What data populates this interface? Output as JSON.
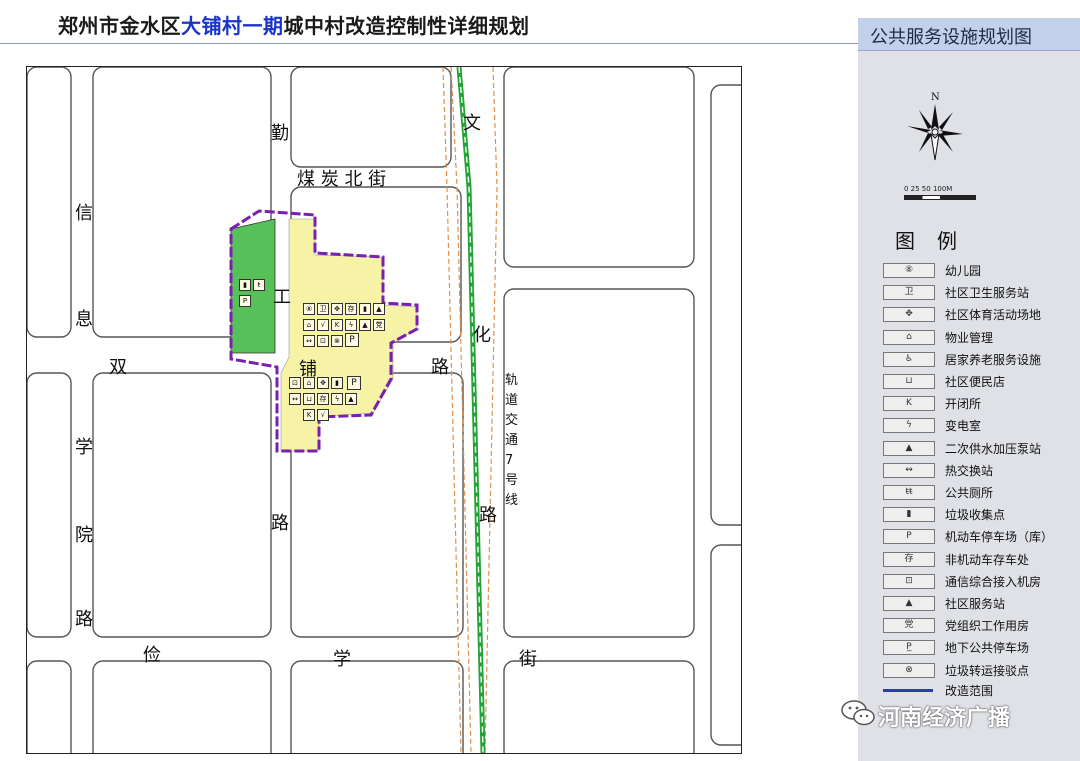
{
  "header": {
    "title_part1": "郑州市金水区",
    "title_highlight": "大铺村一期",
    "title_part2": "城中村改造控制性详细规划"
  },
  "panel": {
    "title": "公共服务设施规划图"
  },
  "compass": {
    "north_label": "N"
  },
  "scale": {
    "ticks": "0  25  50      100M"
  },
  "legend": {
    "title": "图例",
    "items": [
      {
        "label": "幼儿园",
        "icon": "kindergarten-icon",
        "glyph": "⑧"
      },
      {
        "label": "社区卫生服务站",
        "icon": "health-station-icon",
        "glyph": "卫"
      },
      {
        "label": "社区体育活动场地",
        "icon": "sports-field-icon",
        "glyph": "✥"
      },
      {
        "label": "物业管理",
        "icon": "property-management-icon",
        "glyph": "⌂"
      },
      {
        "label": "居家养老服务设施",
        "icon": "elderly-care-icon",
        "glyph": "♿"
      },
      {
        "label": "社区便民店",
        "icon": "convenience-store-icon",
        "glyph": "⊔"
      },
      {
        "label": "开闭所",
        "icon": "switching-station-icon",
        "glyph": "K"
      },
      {
        "label": "变电室",
        "icon": "substation-icon",
        "glyph": "ϟ"
      },
      {
        "label": "二次供水加压泵站",
        "icon": "water-pump-icon",
        "glyph": "▲"
      },
      {
        "label": "热交换站",
        "icon": "heat-exchange-icon",
        "glyph": "↭"
      },
      {
        "label": "公共厕所",
        "icon": "public-toilet-icon",
        "glyph": "ŧŧ"
      },
      {
        "label": "垃圾收集点",
        "icon": "garbage-point-icon",
        "glyph": "▮"
      },
      {
        "label": "机动车停车场（库）",
        "icon": "parking-icon",
        "glyph": "P"
      },
      {
        "label": "非机动车存车处",
        "icon": "bike-parking-icon",
        "glyph": "存"
      },
      {
        "label": "通信综合接入机房",
        "icon": "telecom-room-icon",
        "glyph": "⊡"
      },
      {
        "label": "社区服务站",
        "icon": "community-service-icon",
        "glyph": "▲"
      },
      {
        "label": "党组织工作用房",
        "icon": "party-office-icon",
        "glyph": "党"
      },
      {
        "label": "地下公共停车场",
        "icon": "underground-parking-icon",
        "glyph": "P̲"
      },
      {
        "label": "垃圾转运接驳点",
        "icon": "garbage-transfer-icon",
        "glyph": "⊗"
      }
    ],
    "boundary_label": "改造范围",
    "boundary_color": "#2b3fa8"
  },
  "map": {
    "roads": {
      "qingong": "勤",
      "gong": "工",
      "lu_left": "路",
      "meitan": "煤  炭  北  街",
      "xinxi_1": "信",
      "xinxi_2": "息",
      "xinxi_3": "学",
      "xinxi_4": "院",
      "xinxi_5": "路",
      "shuangpu_1": "双",
      "shuangpu_2": "铺",
      "shuangpu_3": "路",
      "wen": "文",
      "hua": "化",
      "lu_right": "路",
      "rail": "轨道交通7号线",
      "jianxue_1": "俭",
      "jianxue_2": "学",
      "jianxue_3": "街"
    },
    "colors": {
      "green_area": "#58c058",
      "yellow_area": "#f6f3a6",
      "boundary": "#7a1fb0",
      "rail_green": "#21a336",
      "road_orange": "#e0904a"
    }
  },
  "watermark": {
    "text": "河南经济广播"
  }
}
